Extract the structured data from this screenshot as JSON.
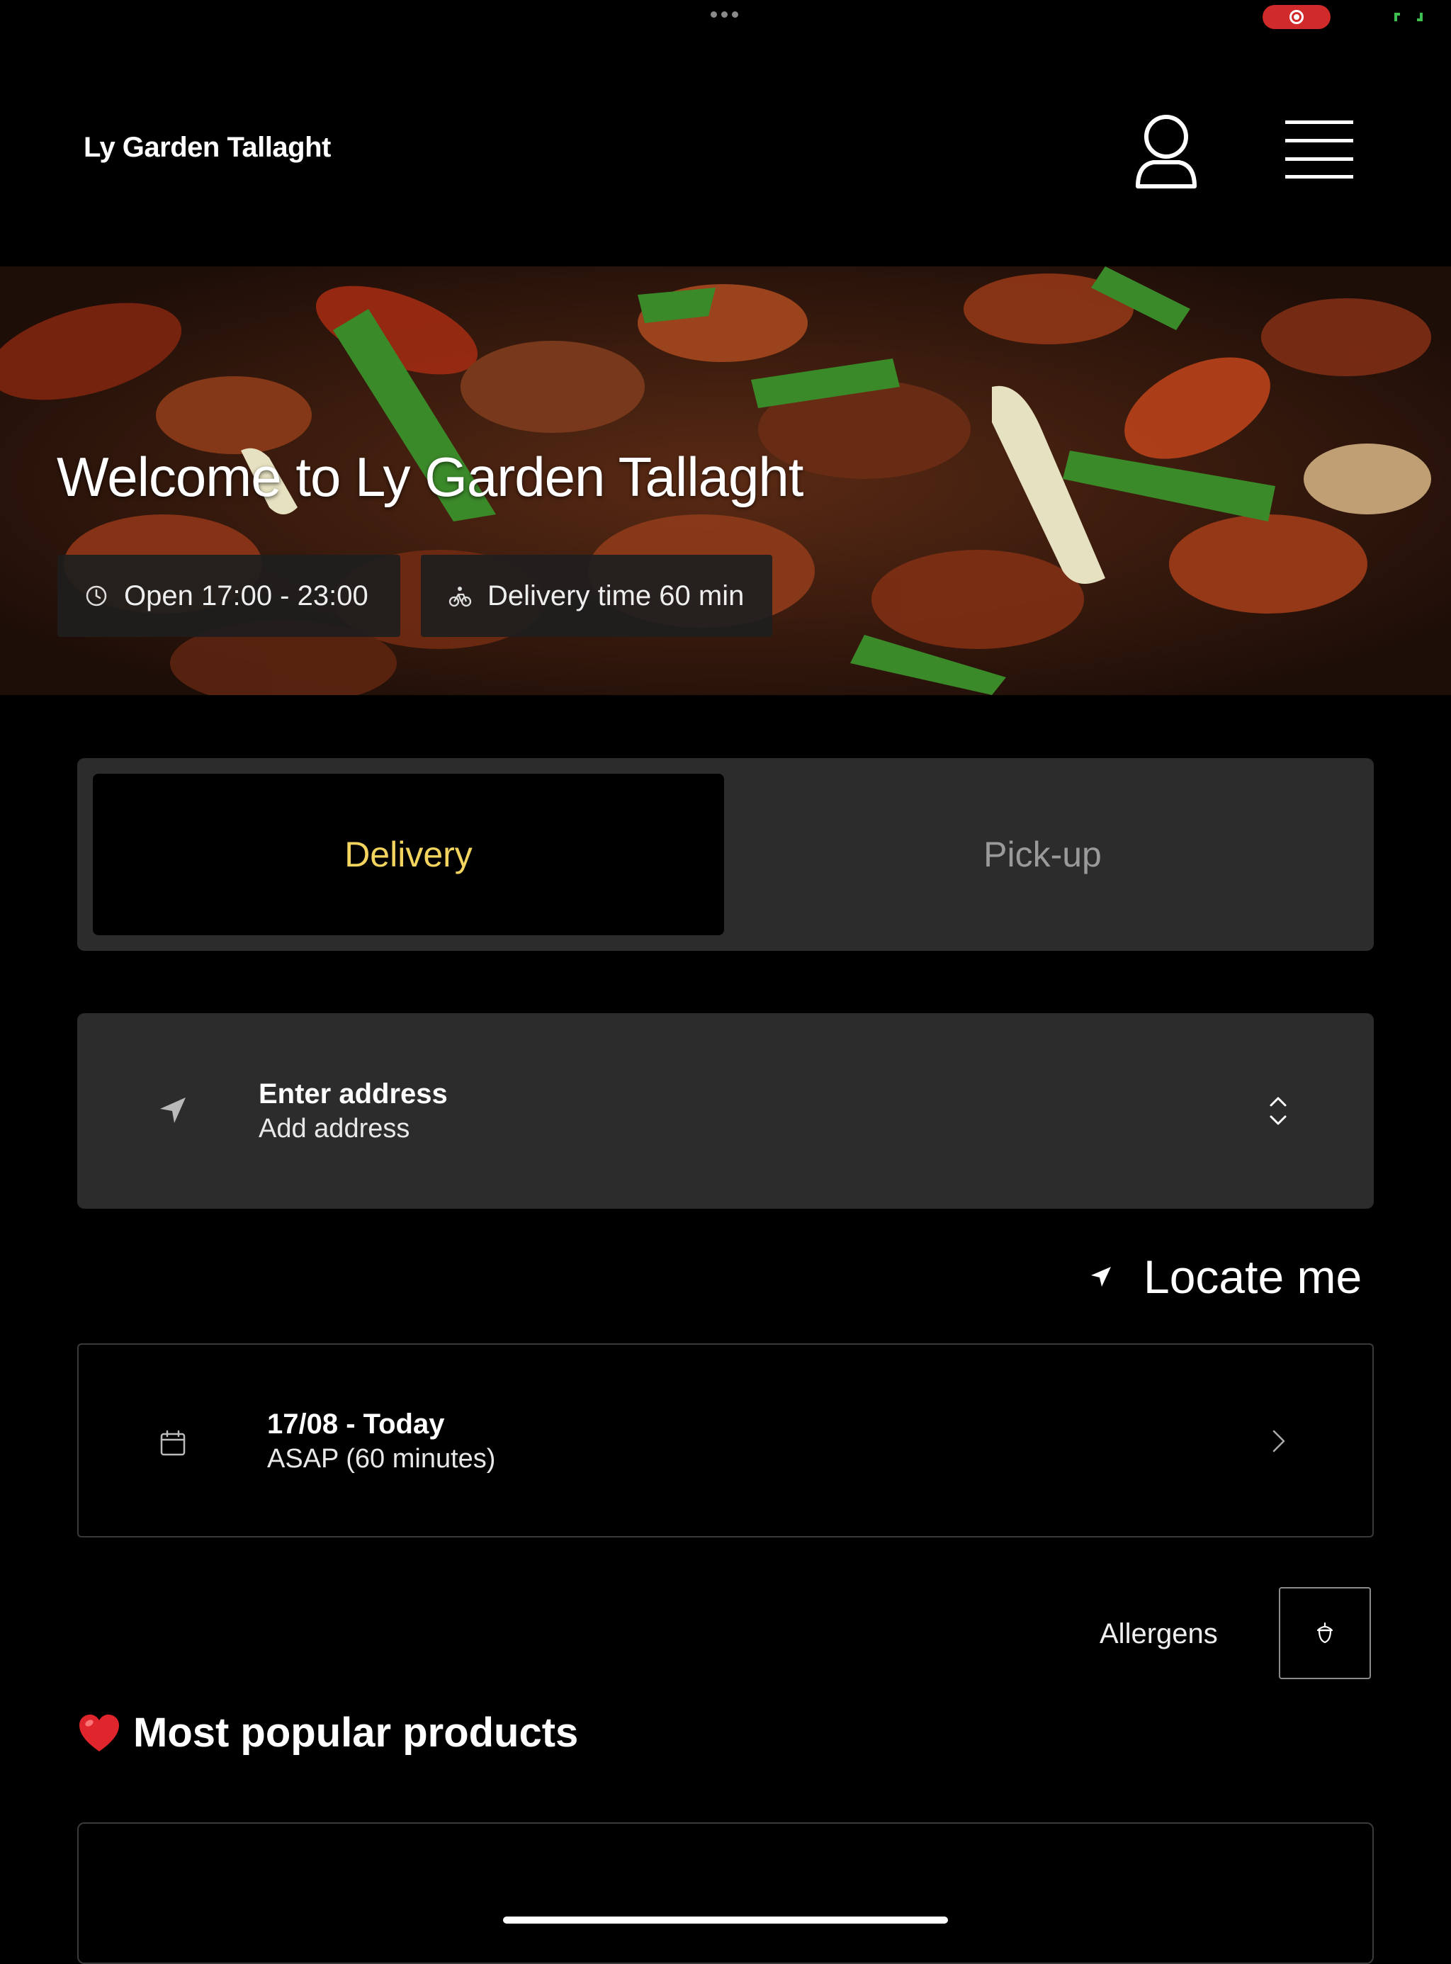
{
  "header": {
    "restaurant_name": "Ly Garden Tallaght",
    "profile_icon": "user-icon",
    "menu_icon": "hamburger-menu-icon"
  },
  "hero": {
    "title": "Welcome to Ly Garden Tallaght",
    "opening_hours": "Open 17:00 - 23:00",
    "delivery_time": "Delivery time 60 min"
  },
  "order_mode": {
    "tabs": [
      {
        "label": "Delivery",
        "active": true
      },
      {
        "label": "Pick-up",
        "active": false
      }
    ],
    "active_color": "#f3d45e"
  },
  "address": {
    "title": "Enter address",
    "value": "Add address"
  },
  "locate": {
    "label": "Locate me"
  },
  "schedule": {
    "date": "17/08 - Today",
    "time": "ASAP (60 minutes)"
  },
  "allergens": {
    "label": "Allergens"
  },
  "popular": {
    "emoji": "❤️",
    "title": "Most popular products"
  },
  "colors": {
    "background": "#000000",
    "card": "#2c2c2c",
    "accent": "#f3d45e",
    "record": "#d12a2a"
  }
}
